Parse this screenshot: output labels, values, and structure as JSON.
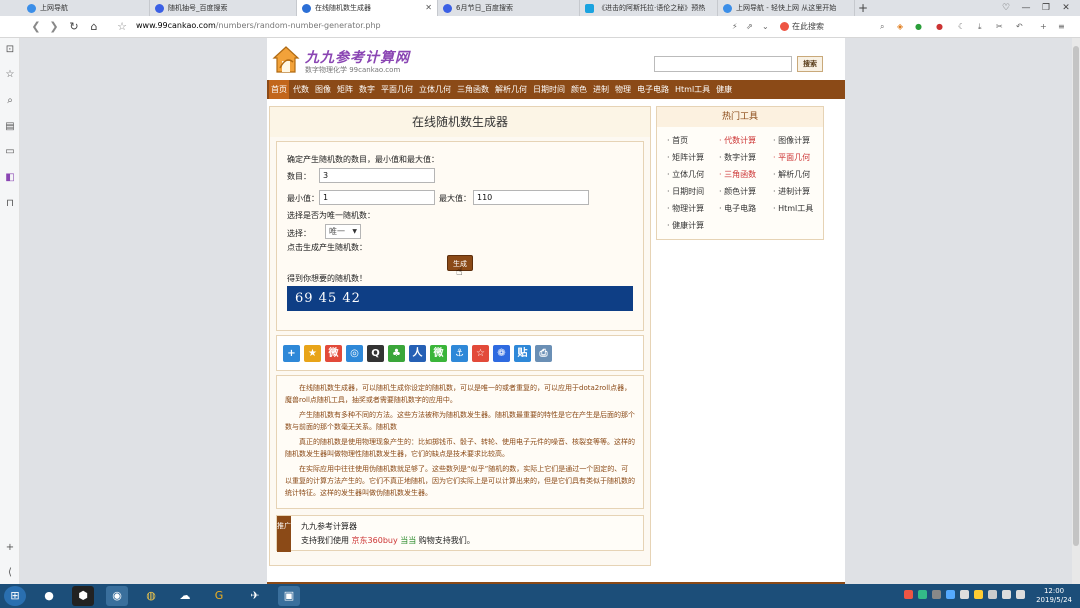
{
  "browser": {
    "tabs": [
      {
        "title": "上网导航",
        "favicon_color": "#3b8ee8",
        "active": false
      },
      {
        "title": "随机抽号_百度搜索",
        "favicon_color": "#3a5fe5",
        "active": false
      },
      {
        "title": "在线随机数生成器",
        "favicon_color": "#2c6fd6",
        "active": true
      },
      {
        "title": "6月节日_百度搜索",
        "favicon_color": "#3a5fe5",
        "active": false
      },
      {
        "title": "《进击的阿斯托拉·语伦之秘》预热",
        "favicon_color": "#1aa3e0",
        "active": false
      },
      {
        "title": "上网导航 - 轻快上网 从这里开始",
        "favicon_color": "#3b8ee8",
        "active": false
      }
    ],
    "new_tab": "+",
    "url_domain": "www.99cankao.com",
    "url_path": "/numbers/random-number-generator.php",
    "search_engine_label": "在此搜索",
    "window_controls": [
      "♡",
      "—",
      "❐",
      "✕"
    ]
  },
  "site": {
    "logo_title": "九九参考计算网",
    "logo_subtitle": "数字物理化学 99cankao.com",
    "search_button": "搜索",
    "search_placeholder": "",
    "menu": [
      "首页",
      "代数",
      "图像",
      "矩阵",
      "数字",
      "平面几何",
      "立体几何",
      "三角函数",
      "解析几何",
      "日期时间",
      "颜色",
      "进制",
      "物理",
      "电子电路",
      "Html工具",
      "健康"
    ],
    "active_menu": 0
  },
  "tool": {
    "title": "在线随机数生成器",
    "intro": "确定产生随机数的数目，最小值和最大值：",
    "count_label": "数目：",
    "count_value": "3",
    "min_label": "最小值：",
    "min_value": "1",
    "max_label": "最大值：",
    "max_value": "110",
    "unique_question": "选择是否为唯一随机数：",
    "select_label": "选择：",
    "select_value": "唯一",
    "click_hint": "点击生成产生随机数：",
    "generate_button": "生成",
    "result_label": "得到你想要的随机数！",
    "result_value": "69  45  42"
  },
  "description": [
    "在线随机数生成器，可以随机生成你设定的随机数，可以是唯一的或者重复的，可以应用于dota2roll点器，魔兽roll点随机工具，抽奖或者需要随机数字的应用中。",
    "产生随机数有多种不同的方法。这些方法被称为随机数发生器。随机数最重要的特性是它在产生是后面的那个数与前面的那个数毫无关系。随机数",
    "真正的随机数是使用物理现象产生的：比如掷钱币、骰子、转轮、使用电子元件的噪音、核裂变等等。这样的随机数发生器叫做物理性随机数发生器，它们的缺点是技术要求比较高。",
    "在实际应用中往往使用伪随机数就足够了。这些数列是“似乎”随机的数，实际上它们是通过一个固定的、可以重复的计算方法产生的。它们不真正地随机，因为它们实际上是可以计算出来的，但是它们具有类似于随机数的统计特征。这样的发生器叫做伪随机数发生器。"
  ],
  "ad": {
    "side": "推广",
    "line1": "九九参考计算器",
    "line2_prefix": "支持我们使用",
    "link1": "京东360buy",
    "link2": "当当",
    "line2_suffix": "购物支持我们。"
  },
  "hot_tools": {
    "title": "热门工具",
    "items": [
      {
        "label": "首页",
        "highlight": false
      },
      {
        "label": "代数计算",
        "highlight": true
      },
      {
        "label": "图像计算",
        "highlight": false
      },
      {
        "label": "矩阵计算",
        "highlight": false
      },
      {
        "label": "数字计算",
        "highlight": false
      },
      {
        "label": "平面几何",
        "highlight": true
      },
      {
        "label": "立体几何",
        "highlight": false
      },
      {
        "label": "三角函数",
        "highlight": true
      },
      {
        "label": "解析几何",
        "highlight": false
      },
      {
        "label": "日期时间",
        "highlight": false
      },
      {
        "label": "颜色计算",
        "highlight": false
      },
      {
        "label": "进制计算",
        "highlight": false
      },
      {
        "label": "物理计算",
        "highlight": false
      },
      {
        "label": "电子电路",
        "highlight": false
      },
      {
        "label": "Html工具",
        "highlight": false
      },
      {
        "label": "健康计算",
        "highlight": false
      }
    ]
  },
  "share_icons": [
    {
      "name": "share-more-icon",
      "color": "#2e88d8",
      "glyph": "+"
    },
    {
      "name": "favorite-star-icon",
      "color": "#e8a419",
      "glyph": "★"
    },
    {
      "name": "weibo-icon",
      "color": "#e24a3a",
      "glyph": "微"
    },
    {
      "name": "tencent-weibo-icon",
      "color": "#2e88d8",
      "glyph": "◎"
    },
    {
      "name": "qq-icon",
      "color": "#333333",
      "glyph": "Q"
    },
    {
      "name": "clover-icon",
      "color": "#3aa63a",
      "glyph": "♣"
    },
    {
      "name": "renren-icon",
      "color": "#2560b5",
      "glyph": "人"
    },
    {
      "name": "wechat-icon",
      "color": "#3ab53a",
      "glyph": "微"
    },
    {
      "name": "anchor-icon",
      "color": "#2e88d8",
      "glyph": "⚓"
    },
    {
      "name": "star-badge-icon",
      "color": "#e24a3a",
      "glyph": "☆"
    },
    {
      "name": "baidu-icon",
      "color": "#2e6ae0",
      "glyph": "❁"
    },
    {
      "name": "tieba-icon",
      "color": "#2e88d8",
      "glyph": "贴"
    },
    {
      "name": "print-icon",
      "color": "#6a8fb5",
      "glyph": "⎙"
    }
  ],
  "taskbar": {
    "clock_time": "12:00",
    "clock_date": "2019/5/24"
  }
}
